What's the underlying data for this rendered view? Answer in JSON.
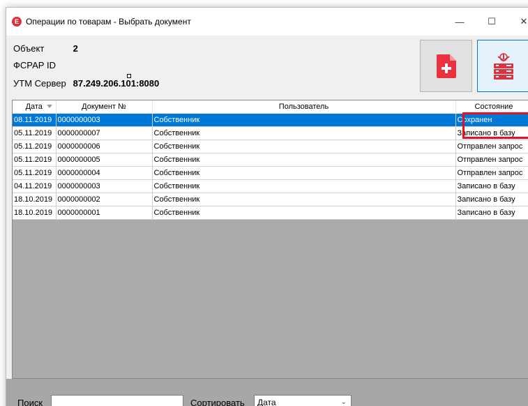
{
  "window": {
    "title": "Операции по товарам - Выбрать документ",
    "app_icon_letter": "E",
    "controls": {
      "minimize": "—",
      "maximize": "☐",
      "close": "✕"
    }
  },
  "info": {
    "object_label": "Объект",
    "object_value": "2",
    "fsrar_label": "ФСРАР ID",
    "fsrar_value": "",
    "utm_label": "УТМ Сервер",
    "utm_value": "87.249.206.101:8080"
  },
  "toolbar": {
    "new_doc_icon": "document-plus-icon",
    "server_icon": "server-add-icon"
  },
  "grid": {
    "columns": [
      "Дата",
      "Документ №",
      "Пользователь",
      "Состояние"
    ],
    "rows": [
      {
        "date": "08.11.2019",
        "doc": "0000000003",
        "user": "Собственник",
        "state": "Сохранен",
        "selected": true
      },
      {
        "date": "05.11.2019",
        "doc": "0000000007",
        "user": "Собственник",
        "state": "Записано в базу",
        "selected": false
      },
      {
        "date": "05.11.2019",
        "doc": "0000000006",
        "user": "Собственник",
        "state": "Отправлен запрос",
        "selected": false
      },
      {
        "date": "05.11.2019",
        "doc": "0000000005",
        "user": "Собственник",
        "state": "Отправлен запрос",
        "selected": false
      },
      {
        "date": "05.11.2019",
        "doc": "0000000004",
        "user": "Собственник",
        "state": "Отправлен запрос",
        "selected": false
      },
      {
        "date": "04.11.2019",
        "doc": "0000000003",
        "user": "Собственник",
        "state": "Записано в базу",
        "selected": false
      },
      {
        "date": "18.10.2019",
        "doc": "0000000002",
        "user": "Собственник",
        "state": "Записано в базу",
        "selected": false
      },
      {
        "date": "18.10.2019",
        "doc": "0000000001",
        "user": "Собственник",
        "state": "Записано в базу",
        "selected": false
      }
    ]
  },
  "bottom": {
    "search_label": "Поиск",
    "search_value": "",
    "sort_label": "Сортировать",
    "sort_value": "Дата"
  },
  "colors": {
    "selection": "#0078d7",
    "highlight": "#e81123",
    "new_doc_red": "#e8333f"
  }
}
